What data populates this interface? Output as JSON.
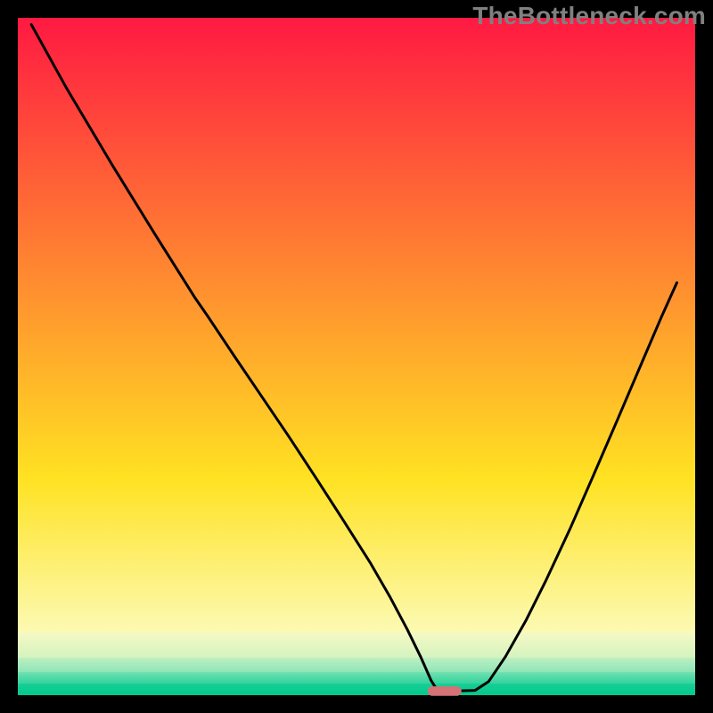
{
  "watermark": "TheBottleneck.com",
  "chart_data": {
    "type": "line",
    "title": "",
    "xlabel": "",
    "ylabel": "",
    "xlim": [
      0,
      100
    ],
    "ylim": [
      0,
      100
    ],
    "series": [
      {
        "name": "bottleneck-curve",
        "x": [
          2.0,
          7.2,
          13.8,
          20.4,
          26.2,
          28.0,
          32.0,
          36.0,
          40.0,
          44.0,
          48.0,
          52.0,
          55.0,
          57.5,
          59.5,
          61.0,
          62.0,
          62.7,
          64.0,
          67.5,
          69.5,
          72.0,
          75.0,
          78.0,
          81.5,
          85.0,
          88.5,
          92.0,
          95.0,
          97.3
        ],
        "values": [
          99.0,
          89.6,
          78.5,
          67.8,
          58.6,
          56.0,
          50.0,
          44.1,
          38.2,
          32.1,
          25.9,
          19.6,
          14.4,
          9.7,
          5.6,
          2.2,
          0.6,
          0.6,
          0.6,
          0.7,
          2.0,
          5.7,
          11.0,
          17.0,
          24.5,
          32.5,
          40.6,
          48.8,
          55.8,
          60.9
        ]
      }
    ],
    "gradient_bands": [
      {
        "from": 0.0,
        "to": 68.0,
        "top": "#ff1942",
        "bottom": "#ffe222"
      },
      {
        "from": 68.0,
        "to": 90.7,
        "top": "#ffe222",
        "bottom": "#fcfab3"
      },
      {
        "from": 90.7,
        "to": 94.5,
        "top": "#f6f9c4",
        "bottom": "#d3f3bf"
      },
      {
        "from": 94.5,
        "to": 96.6,
        "top": "#bcefc1",
        "bottom": "#8de5b8"
      },
      {
        "from": 96.6,
        "to": 98.3,
        "top": "#71dfb0",
        "bottom": "#2ed39d"
      },
      {
        "from": 98.3,
        "to": 100.0,
        "top": "#18ce95",
        "bottom": "#01c98e"
      }
    ],
    "marker": {
      "x": 63.0,
      "y": 0.6,
      "width": 5.0,
      "height": 1.4,
      "color": "#d47275"
    },
    "frame_thickness": 2.5
  }
}
